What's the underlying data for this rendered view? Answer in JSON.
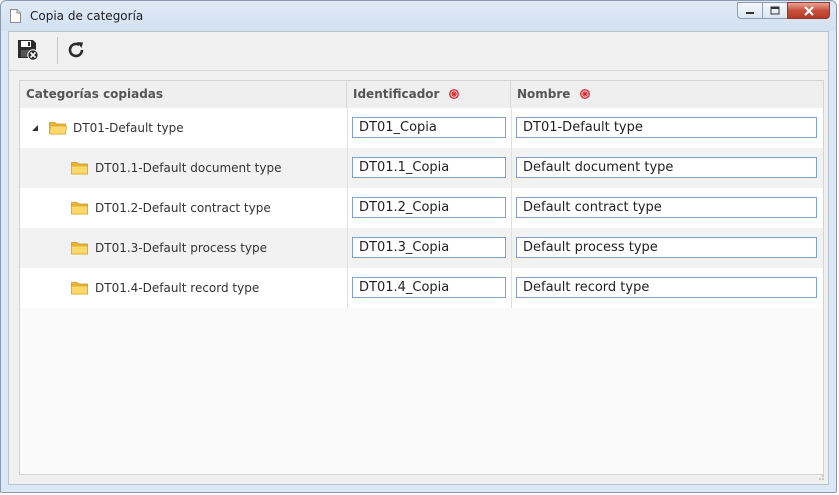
{
  "window": {
    "title": "Copia de categoría",
    "minimize_icon": "minimize-icon",
    "maximize_icon": "maximize-icon",
    "close_icon": "close-icon"
  },
  "toolbar": {
    "buttons": [
      {
        "icon": "save-close-icon"
      },
      {
        "icon": "refresh-icon"
      }
    ]
  },
  "grid": {
    "columns": [
      {
        "label": "Categorías copiadas",
        "required": false
      },
      {
        "label": "Identificador",
        "required": true
      },
      {
        "label": "Nombre",
        "required": true
      }
    ],
    "rows": [
      {
        "category": "DT01-Default type",
        "level": 0,
        "expanded": true,
        "identificador": "DT01_Copia",
        "nombre": "DT01-Default type"
      },
      {
        "category": "DT01.1-Default document type",
        "level": 1,
        "identificador": "DT01.1_Copia",
        "nombre": "Default document type"
      },
      {
        "category": "DT01.2-Default contract type",
        "level": 1,
        "identificador": "DT01.2_Copia",
        "nombre": "Default contract type"
      },
      {
        "category": "DT01.3-Default process type",
        "level": 1,
        "identificador": "DT01.3_Copia",
        "nombre": "Default process type"
      },
      {
        "category": "DT01.4-Default record type",
        "level": 1,
        "identificador": "DT01.4_Copia",
        "nombre": "Default record type"
      }
    ]
  },
  "colors": {
    "folder": "#f5c842",
    "required_marker": "#d9242a",
    "input_border": "#7fa3c8"
  }
}
